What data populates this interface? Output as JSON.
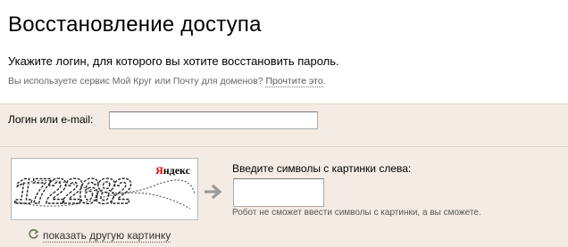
{
  "page": {
    "title": "Восстановление доступа",
    "subtitle": "Укажите логин, для которого вы хотите восстановить пароль.",
    "note_text": "Вы используете сервис Мой Круг или Почту для доменов? ",
    "note_link": "Прочтите это",
    "note_end": "."
  },
  "login": {
    "label": "Логин или e-mail:",
    "value": "",
    "placeholder": ""
  },
  "captcha": {
    "image_text": "1722682",
    "brand_first": "Я",
    "brand_rest": "ндекс",
    "label": "Введите символы с картинки слева:",
    "value": "",
    "hint": "Робот не сможет ввести символы с картинки, а вы сможете.",
    "refresh_label": "показать другую картинку",
    "refresh_icon": "refresh-icon",
    "arrow_icon": "arrow-right-icon"
  },
  "colors": {
    "panel_bg": "#f4ece4",
    "brand_red": "#e60000"
  }
}
